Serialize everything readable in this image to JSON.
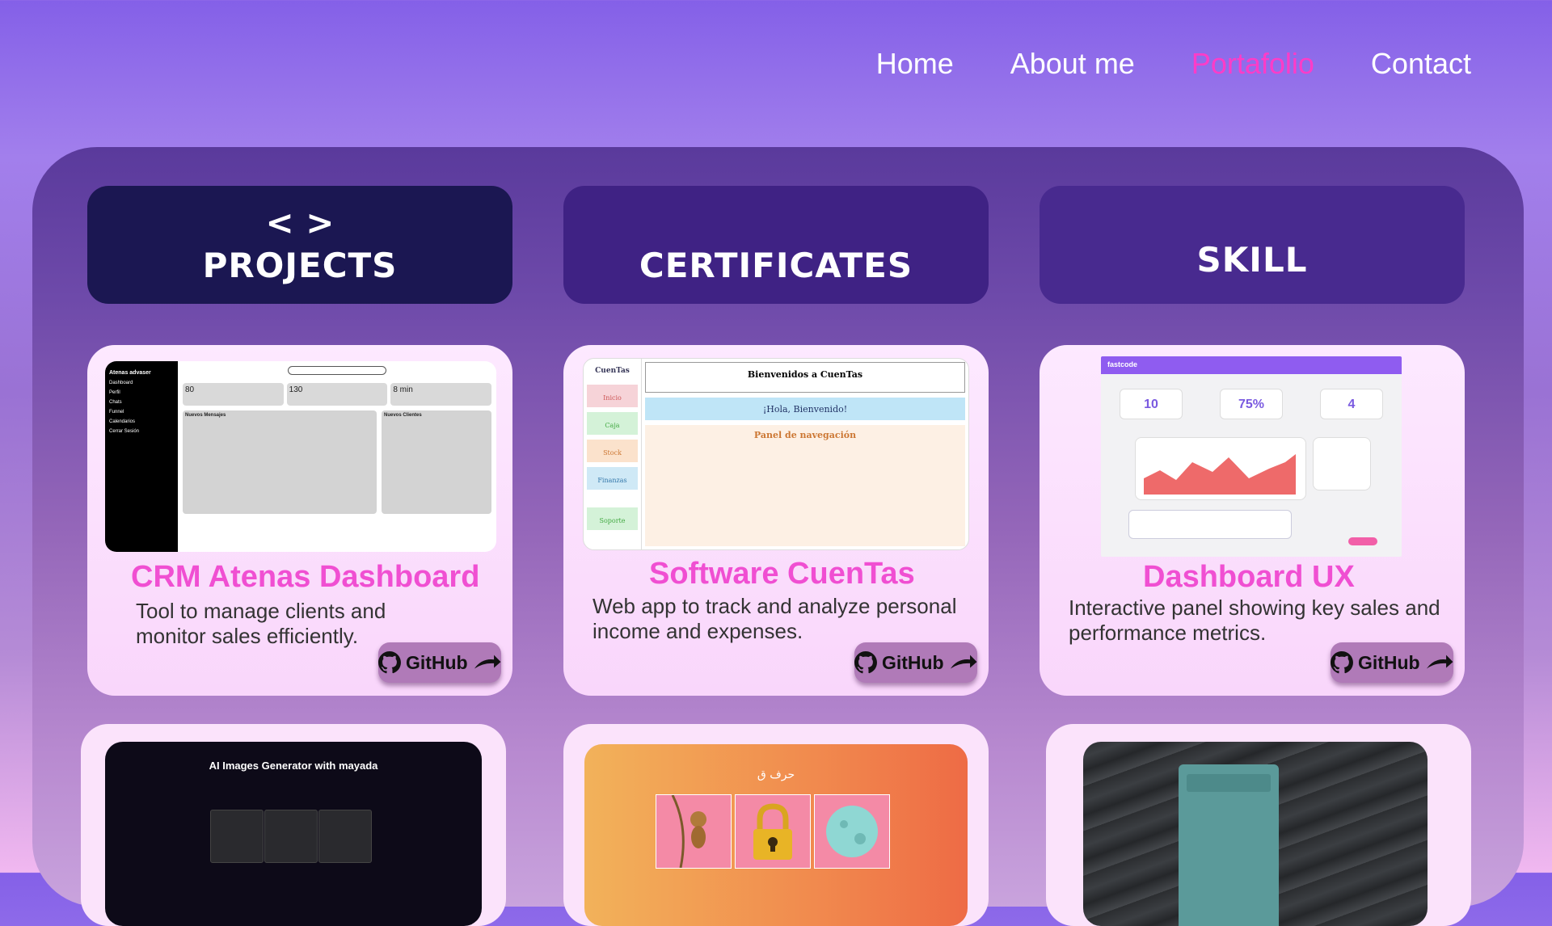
{
  "nav": {
    "home": "Home",
    "about": "About me",
    "portfolio": "Portafolio",
    "contact": "Contact"
  },
  "tabs": {
    "projects_code": "< >",
    "projects": "PROJECTS",
    "certificates": "CERTIFICATES",
    "skill": "SKILL"
  },
  "projects": [
    {
      "title": "CRM Atenas Dashboard",
      "description": "Tool to manage clients and monitor sales efficiently.",
      "github": "GitHub",
      "thumb": {
        "brand": "Atenas advaser",
        "nav": [
          "Dashboard",
          "Perfil",
          "Chats",
          "Funnel",
          "Calendarios",
          "Cerrar Sesión"
        ],
        "stats": [
          "80",
          "130",
          "8 min"
        ],
        "messages_title": "Nuevos Mensajes",
        "clients_title": "Nuevos Clientes"
      }
    },
    {
      "title": "Software CuenTas",
      "description": "Web app to track and analyze personal income and expenses.",
      "github": "GitHub",
      "thumb": {
        "brand": "CuenTas",
        "welcome": "Bienvenidos a CuenTas",
        "hello": "¡Hola, Bienvenido!",
        "panel": "Panel de navegación",
        "nav": [
          "Inicio",
          "Caja",
          "Stock",
          "Finanzas",
          "Soporte"
        ]
      }
    },
    {
      "title": "Dashboard UX",
      "description": "Interactive panel showing key sales and  performance metrics.",
      "github": "GitHub",
      "thumb": {
        "brand": "fastcode",
        "kpis": [
          "10",
          "75%",
          "4"
        ]
      }
    }
  ],
  "bottom_cards": [
    {
      "title": "AI Images Generator with mayada"
    },
    {
      "title": "حرف ق"
    },
    {
      "title": ""
    }
  ],
  "colors": {
    "accent": "#f04fd2",
    "nav_active": "#ff3cc8",
    "tab_dark": "#1b1752"
  }
}
